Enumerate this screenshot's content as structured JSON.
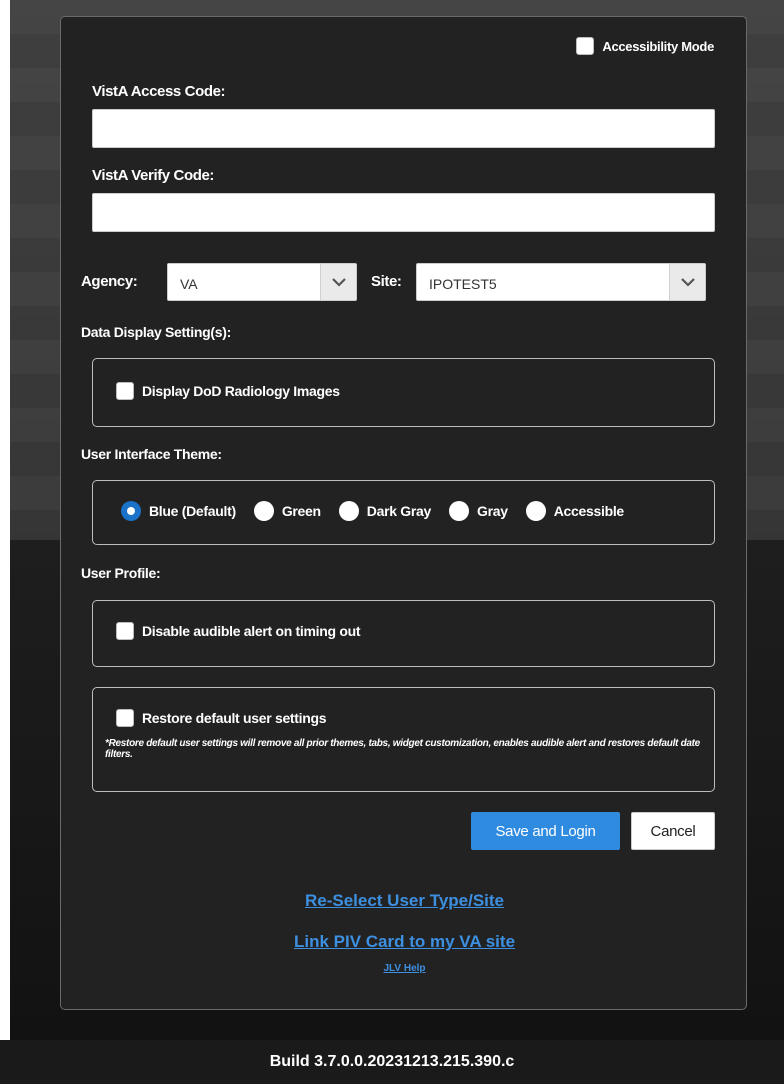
{
  "accessibility_mode": {
    "label": "Accessibility Mode",
    "checked": false
  },
  "access_code": {
    "label": "VistA Access Code:",
    "value": ""
  },
  "verify_code": {
    "label": "VistA Verify Code:",
    "value": ""
  },
  "agency": {
    "label": "Agency:",
    "selected": "VA"
  },
  "site": {
    "label": "Site:",
    "selected": "IPOTEST5"
  },
  "data_display": {
    "title": "Data Display Setting(s):",
    "dod_images": {
      "label": "Display DoD Radiology Images",
      "checked": false
    }
  },
  "theme": {
    "title": "User Interface Theme:",
    "options": [
      "Blue (Default)",
      "Green",
      "Dark Gray",
      "Gray",
      "Accessible"
    ],
    "selected": "Blue (Default)"
  },
  "profile": {
    "title": "User Profile:",
    "disable_alert": {
      "label": "Disable audible alert on timing out",
      "checked": false
    },
    "restore_defaults": {
      "label": "Restore default user settings",
      "checked": false,
      "note": "*Restore default user settings will remove all prior themes, tabs, widget customization, enables audible alert and restores default date filters."
    }
  },
  "buttons": {
    "save_login": "Save and Login",
    "cancel": "Cancel"
  },
  "links": {
    "reselect": "Re-Select User Type/Site",
    "link_piv": "Link PIV Card to my VA site",
    "help": "JLV Help"
  },
  "footer": {
    "build": "Build 3.7.0.0.20231213.215.390.c"
  },
  "colors": {
    "primary": "#2f8be0",
    "link": "#3d8fe0",
    "panel": "#222222",
    "radio_selected": "#1a73c8"
  }
}
